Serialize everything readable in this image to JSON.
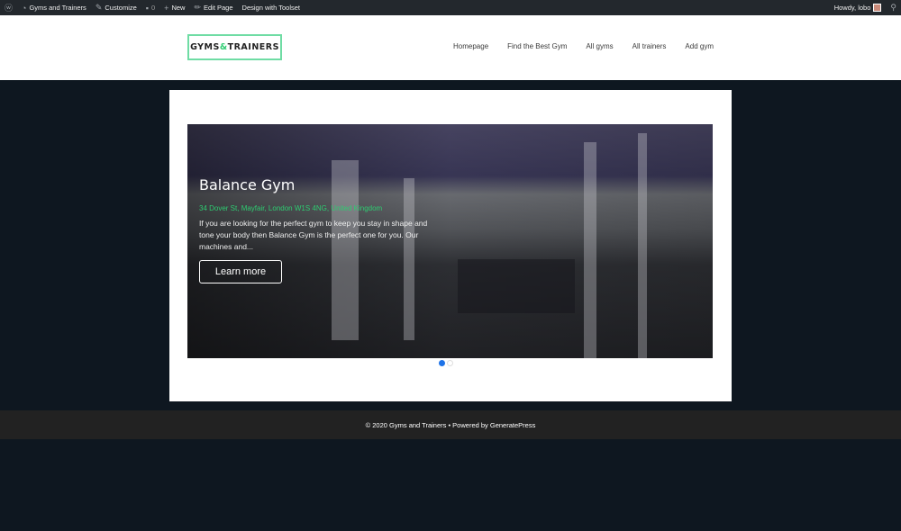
{
  "admin_bar": {
    "items": [
      {
        "icon": "wordpress-icon",
        "label": ""
      },
      {
        "icon": "dashboard-icon",
        "label": "Gyms and Trainers"
      },
      {
        "icon": "brush-icon",
        "label": "Customize"
      },
      {
        "icon": "comment-icon",
        "label": "0"
      },
      {
        "icon": "plus-icon",
        "label": "New"
      },
      {
        "icon": "pencil-icon",
        "label": "Edit Page"
      },
      {
        "icon": "",
        "label": "Design with Toolset"
      }
    ],
    "greeting": "Howdy, lobo"
  },
  "header": {
    "logo": {
      "left": "GYMS",
      "amp": "&",
      "right": "TRAINERS"
    },
    "nav": [
      "Homepage",
      "Find the Best Gym",
      "All gyms",
      "All trainers",
      "Add gym"
    ]
  },
  "slider": {
    "title": "Balance Gym",
    "address": "34 Dover St, Mayfair, London W1S 4NG, United Kingdom",
    "description": "If you are looking for the perfect gym to keep you stay in shape and tone your body then Balance Gym is the perfect one for you. Our machines and...",
    "button": "Learn more",
    "active_slide": 1,
    "slide_count": 2
  },
  "footer": {
    "text": "© 2020 Gyms and Trainers • Powered by GeneratePress"
  },
  "colors": {
    "accent": "#2ecc71",
    "dot_active": "#1e73e8",
    "background": "#0e1720"
  }
}
